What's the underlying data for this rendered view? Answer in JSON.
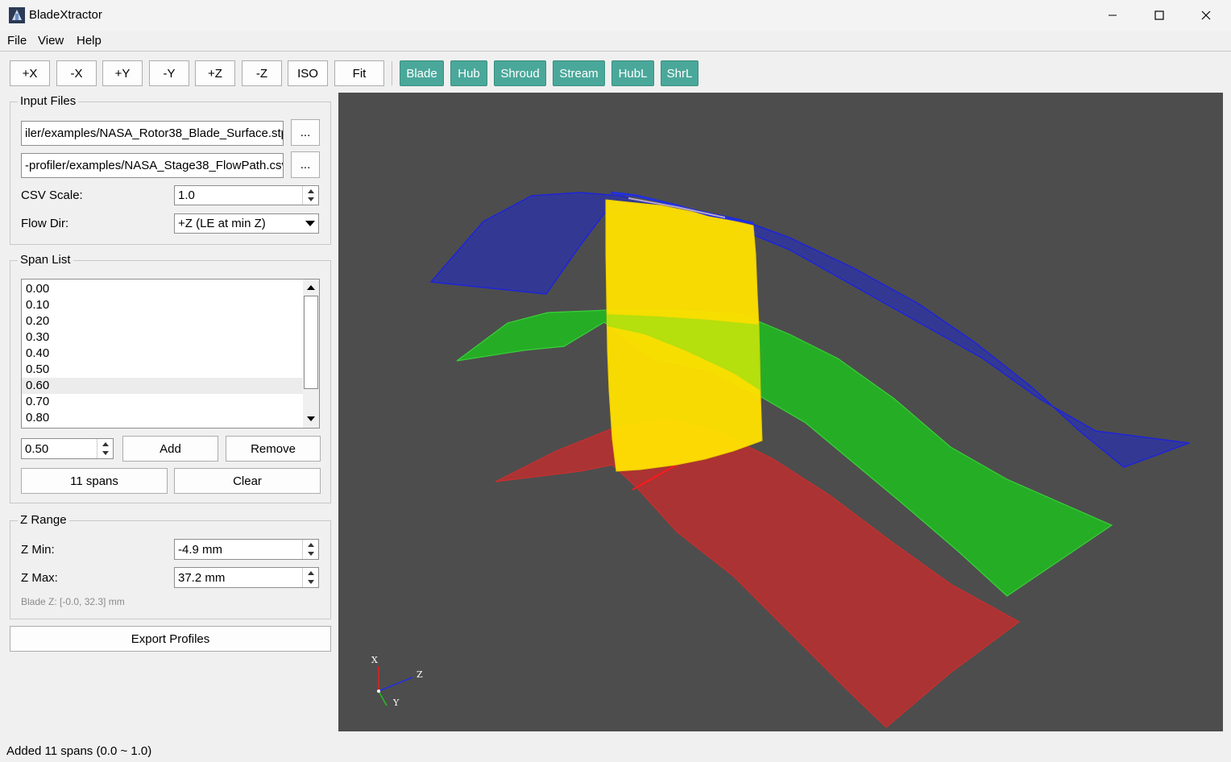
{
  "window": {
    "title": "BladeXtractor"
  },
  "menu": [
    "File",
    "View",
    "Help"
  ],
  "toolbar": {
    "view_buttons": [
      "+X",
      "-X",
      "+Y",
      "-Y",
      "+Z",
      "-Z",
      "ISO",
      "Fit"
    ],
    "toggle_buttons": [
      "Blade",
      "Hub",
      "Shroud",
      "Stream",
      "HubL",
      "ShrL"
    ],
    "toggle_color": "#4aa89a"
  },
  "input_files": {
    "group_title": "Input Files",
    "blade_file": "iler/examples/NASA_Rotor38_Blade_Surface.stp",
    "flowpath_file": "-profiler/examples/NASA_Stage38_FlowPath.csv",
    "browse_label": "...",
    "csv_scale_label": "CSV Scale:",
    "csv_scale_value": "1.0",
    "flow_dir_label": "Flow Dir:",
    "flow_dir_value": "+Z (LE at min Z)"
  },
  "span_list": {
    "group_title": "Span List",
    "items": [
      "0.00",
      "0.10",
      "0.20",
      "0.30",
      "0.40",
      "0.50",
      "0.60",
      "0.70",
      "0.80"
    ],
    "selected_index": 6,
    "new_span_value": "0.50",
    "add_label": "Add",
    "remove_label": "Remove",
    "count_label": "11 spans",
    "clear_label": "Clear"
  },
  "z_range": {
    "group_title": "Z Range",
    "z_min_label": "Z Min:",
    "z_min_value": "-4.9 mm",
    "z_max_label": "Z Max:",
    "z_max_value": "37.2 mm",
    "blade_z_info": "Blade Z: [-0.0, 32.3] mm"
  },
  "export_label": "Export Profiles",
  "viewport": {
    "background": "#4d4d4d",
    "axes": {
      "x": "X",
      "y": "Y",
      "z": "Z"
    },
    "colors": {
      "shroud": "#2f36a0",
      "stream": "#22b822",
      "hub": "#b03030",
      "blade": "#ffe000"
    }
  },
  "status": "Added 11 spans (0.0 ~ 1.0)"
}
